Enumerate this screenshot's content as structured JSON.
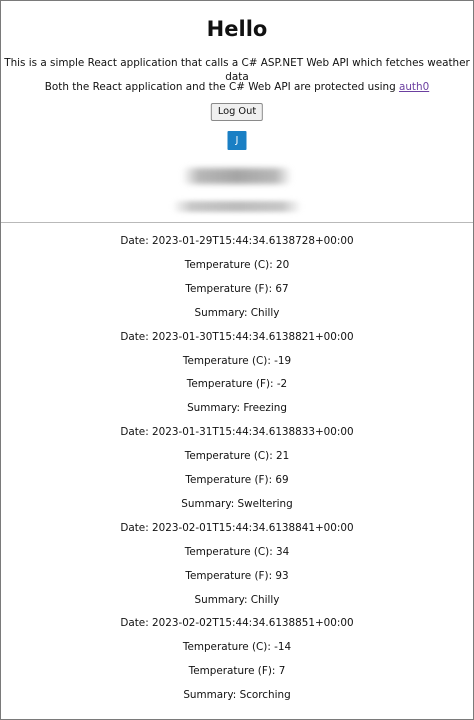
{
  "header": {
    "title": "Hello",
    "intro_line1": "This is a simple React application that calls a C# ASP.NET Web API which fetches weather data",
    "intro_line2_prefix": "Both the React application and the C# Web API are protected using ",
    "intro_link": "auth0",
    "logout_label": "Log Out",
    "avatar_initial": "J"
  },
  "labels": {
    "date": "Date: ",
    "temp_c": "Temperature (C): ",
    "temp_f": "Temperature (F): ",
    "summary": "Summary: "
  },
  "forecasts": [
    {
      "date": "2023-01-29T15:44:34.6138728+00:00",
      "temperatureC": "20",
      "temperatureF": "67",
      "summary": "Chilly"
    },
    {
      "date": "2023-01-30T15:44:34.6138821+00:00",
      "temperatureC": "-19",
      "temperatureF": "-2",
      "summary": "Freezing"
    },
    {
      "date": "2023-01-31T15:44:34.6138833+00:00",
      "temperatureC": "21",
      "temperatureF": "69",
      "summary": "Sweltering"
    },
    {
      "date": "2023-02-01T15:44:34.6138841+00:00",
      "temperatureC": "34",
      "temperatureF": "93",
      "summary": "Chilly"
    },
    {
      "date": "2023-02-02T15:44:34.6138851+00:00",
      "temperatureC": "-14",
      "temperatureF": "7",
      "summary": "Scorching"
    }
  ]
}
